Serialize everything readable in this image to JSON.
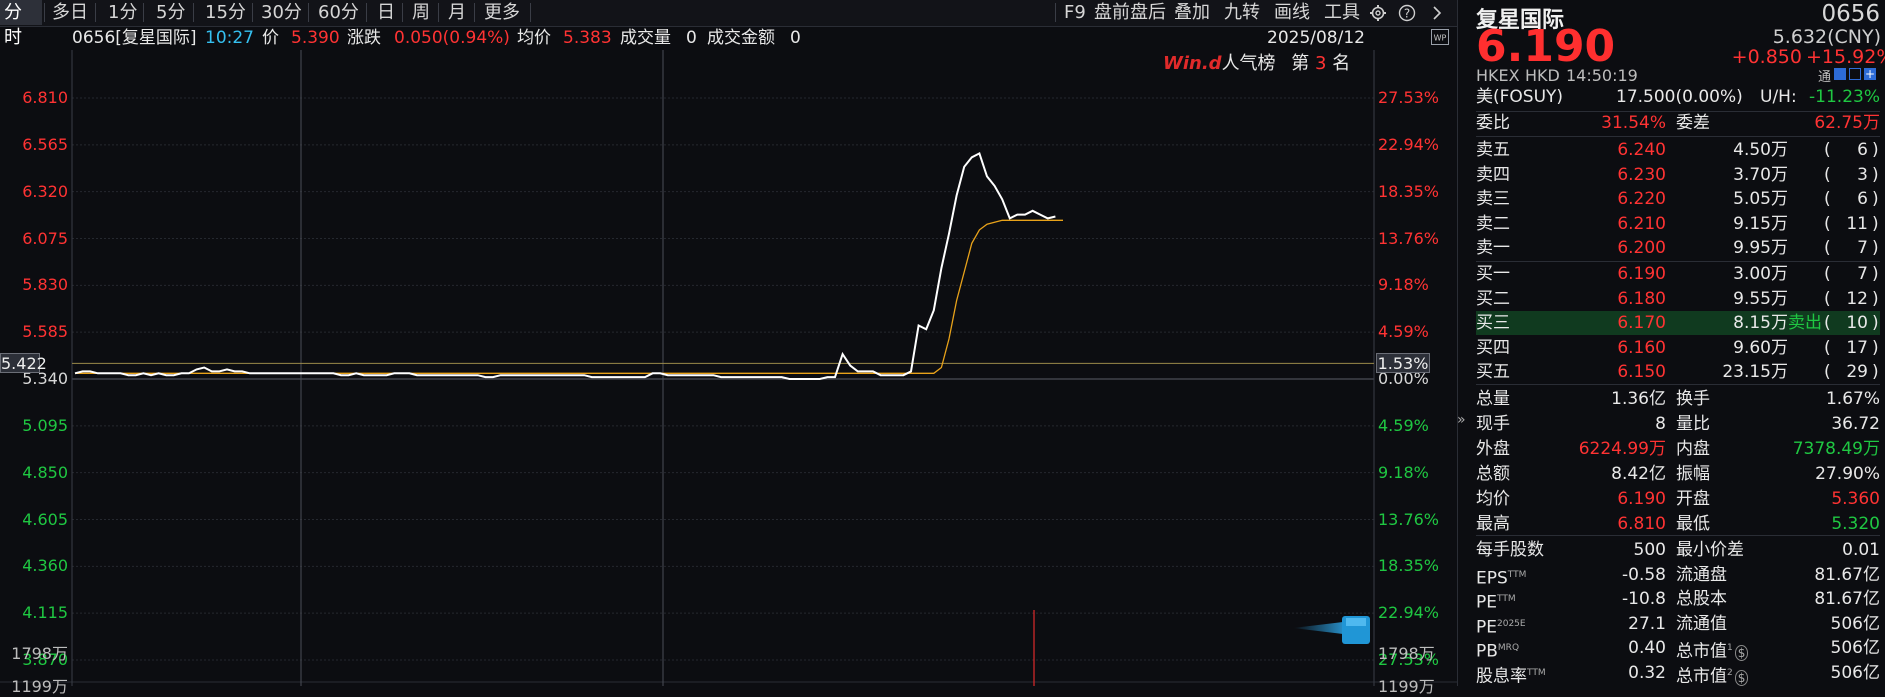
{
  "toolbar": {
    "tabs": [
      "分时",
      "多日",
      "1分",
      "5分",
      "15分",
      "30分",
      "60分",
      "日",
      "周",
      "月",
      "更多"
    ],
    "right_items": [
      "F9",
      "盘前盘后",
      "叠加",
      "九转",
      "画线",
      "工具"
    ],
    "gear_icon": "gear-icon",
    "help_icon": "help-icon",
    "next_icon": "chevron-right-icon"
  },
  "info": {
    "code_name": "0656[复星国际]",
    "time": "10:27",
    "price_label": "价",
    "price": "5.390",
    "change_label": "涨跌",
    "change": "0.050(0.94%)",
    "avg_label": "均价",
    "avg": "5.383",
    "volume_label": "成交量",
    "volume": "0",
    "amount_label": "成交金额",
    "amount": "0",
    "date": "2025/08/12"
  },
  "badge": {
    "brand": "Win.d",
    "rank_label": "人气榜",
    "rank_prefix": "第",
    "rank": "3",
    "rank_suffix": "名"
  },
  "chart_data": {
    "type": "line",
    "prev_close": 5.34,
    "current_line_value": 5.422,
    "current_line_label": "5.422",
    "current_line_pct": "1.53%",
    "ylim": [
      3.87,
      6.81
    ],
    "left_ticks": [
      "6.810",
      "6.565",
      "6.320",
      "6.075",
      "5.830",
      "5.585",
      "5.340",
      "5.095",
      "4.850",
      "4.605",
      "4.360",
      "4.115",
      "3.870"
    ],
    "right_ticks": [
      "27.53%",
      "22.94%",
      "18.35%",
      "13.76%",
      "9.18%",
      "4.59%",
      "0.00%",
      "4.59%",
      "9.18%",
      "13.76%",
      "18.35%",
      "22.94%",
      "27.53%"
    ],
    "volume_tick_left": "1798万",
    "volume_tick_right": "1798万",
    "volume_tick_next_left": "1199万",
    "volume_tick_next_right": "1199万",
    "series": [
      {
        "values": [
          5.37,
          5.38,
          5.38,
          5.37,
          5.37,
          5.37,
          5.37,
          5.36,
          5.36,
          5.37,
          5.36,
          5.37,
          5.36,
          5.36,
          5.37,
          5.37,
          5.39,
          5.4,
          5.38,
          5.38,
          5.39,
          5.38,
          5.38,
          5.37,
          5.37,
          5.37,
          5.37,
          5.37,
          5.37,
          5.37,
          5.37,
          5.37,
          5.37,
          5.37,
          5.37,
          5.36,
          5.36,
          5.37,
          5.36,
          5.36,
          5.36,
          5.36,
          5.37,
          5.37,
          5.37,
          5.36,
          5.36,
          5.36,
          5.36,
          5.36,
          5.36,
          5.36,
          5.36,
          5.36,
          5.35,
          5.35,
          5.36,
          5.36,
          5.36,
          5.36,
          5.36,
          5.36,
          5.36,
          5.36,
          5.36,
          5.36,
          5.36,
          5.36,
          5.35,
          5.35,
          5.35,
          5.35,
          5.35,
          5.35,
          5.35,
          5.35,
          5.37,
          5.37,
          5.36,
          5.36,
          5.36,
          5.36,
          5.36,
          5.36,
          5.36,
          5.35,
          5.35,
          5.35,
          5.35,
          5.35,
          5.35,
          5.35,
          5.35,
          5.35,
          5.34,
          5.34,
          5.34,
          5.34,
          5.34,
          5.35,
          5.35,
          5.47,
          5.41,
          5.38,
          5.38,
          5.38,
          5.36,
          5.36,
          5.36,
          5.36,
          5.38,
          5.62,
          5.6,
          5.7,
          5.92,
          6.1,
          6.3,
          6.45,
          6.5,
          6.52,
          6.4,
          6.35,
          6.28,
          6.18,
          6.2,
          6.2,
          6.22,
          6.2,
          6.18,
          6.19
        ]
      },
      {
        "values": [
          5.37,
          5.37,
          5.37,
          5.37,
          5.37,
          5.37,
          5.37,
          5.37,
          5.37,
          5.37,
          5.37,
          5.37,
          5.37,
          5.37,
          5.37,
          5.37,
          5.37,
          5.37,
          5.37,
          5.37,
          5.37,
          5.37,
          5.37,
          5.37,
          5.37,
          5.37,
          5.37,
          5.37,
          5.37,
          5.37,
          5.37,
          5.37,
          5.37,
          5.37,
          5.37,
          5.37,
          5.37,
          5.37,
          5.37,
          5.37,
          5.37,
          5.37,
          5.37,
          5.37,
          5.37,
          5.37,
          5.37,
          5.37,
          5.37,
          5.37,
          5.37,
          5.37,
          5.37,
          5.37,
          5.37,
          5.37,
          5.37,
          5.37,
          5.37,
          5.37,
          5.37,
          5.37,
          5.37,
          5.37,
          5.37,
          5.37,
          5.37,
          5.37,
          5.37,
          5.37,
          5.37,
          5.37,
          5.37,
          5.37,
          5.37,
          5.37,
          5.37,
          5.37,
          5.37,
          5.37,
          5.37,
          5.37,
          5.37,
          5.37,
          5.37,
          5.37,
          5.37,
          5.37,
          5.37,
          5.37,
          5.37,
          5.37,
          5.37,
          5.37,
          5.37,
          5.37,
          5.37,
          5.37,
          5.37,
          5.37,
          5.37,
          5.37,
          5.37,
          5.37,
          5.37,
          5.37,
          5.37,
          5.37,
          5.37,
          5.37,
          5.37,
          5.37,
          5.37,
          5.37,
          5.4,
          5.55,
          5.75,
          5.9,
          6.05,
          6.12,
          6.15,
          6.16,
          6.17,
          6.17,
          6.17,
          6.17,
          6.17,
          6.17,
          6.17,
          6.17,
          6.17
        ]
      }
    ]
  },
  "panel": {
    "name": "复星国际",
    "code": "0656",
    "price": "6.190",
    "cny_price": "5.632(CNY)",
    "change": "+0.850",
    "change_pct": "+15.92%",
    "exchange": "HKEX",
    "currency": "HKD",
    "time": "14:50:19",
    "tong": "通",
    "us_label": "美(FOSUY)",
    "us_value": "17.500(0.00%)",
    "uh_label": "U/H:",
    "uh_value": "-11.23%",
    "weibi_label": "委比",
    "weibi": "31.54%",
    "weicha_label": "委差",
    "weicha": "62.75万",
    "asks": [
      {
        "label": "卖五",
        "price": "6.240",
        "vol": "4.50万",
        "count": "6"
      },
      {
        "label": "卖四",
        "price": "6.230",
        "vol": "3.70万",
        "count": "3"
      },
      {
        "label": "卖三",
        "price": "6.220",
        "vol": "5.05万",
        "count": "6"
      },
      {
        "label": "卖二",
        "price": "6.210",
        "vol": "9.15万",
        "count": "11"
      },
      {
        "label": "卖一",
        "price": "6.200",
        "vol": "9.95万",
        "count": "7"
      }
    ],
    "bids": [
      {
        "label": "买一",
        "price": "6.190",
        "vol": "3.00万",
        "count": "7"
      },
      {
        "label": "买二",
        "price": "6.180",
        "vol": "9.55万",
        "count": "12"
      },
      {
        "label": "买三",
        "price": "6.170",
        "vol": "8.15万",
        "count": "10",
        "tag": "卖出"
      },
      {
        "label": "买四",
        "price": "6.160",
        "vol": "9.60万",
        "count": "17"
      },
      {
        "label": "买五",
        "price": "6.150",
        "vol": "23.15万",
        "count": "29"
      }
    ],
    "stats": [
      {
        "l1": "总量",
        "v1": "1.36亿",
        "c1": "white",
        "l2": "换手",
        "v2": "1.67%",
        "c2": "white"
      },
      {
        "l1": "现手",
        "v1": "8",
        "c1": "white",
        "l2": "量比",
        "v2": "36.72",
        "c2": "white"
      },
      {
        "l1": "外盘",
        "v1": "6224.99万",
        "c1": "red",
        "l2": "内盘",
        "v2": "7378.49万",
        "c2": "green"
      },
      {
        "l1": "总额",
        "v1": "8.42亿",
        "c1": "white",
        "l2": "振幅",
        "v2": "27.90%",
        "c2": "white"
      },
      {
        "l1": "均价",
        "v1": "6.190",
        "c1": "red",
        "l2": "开盘",
        "v2": "5.360",
        "c2": "red"
      },
      {
        "l1": "最高",
        "v1": "6.810",
        "c1": "red",
        "l2": "最低",
        "v2": "5.320",
        "c2": "green"
      }
    ],
    "stats2": [
      {
        "l1": "每手股数",
        "v1": "500",
        "l2": "最小价差",
        "v2": "0.01"
      },
      {
        "l1": "EPS",
        "s1": "TTM",
        "v1": "-0.58",
        "l2": "流通盘",
        "v2": "81.67亿"
      },
      {
        "l1": "PE",
        "s1": "TTM",
        "v1": "-10.8",
        "l2": "总股本",
        "v2": "81.67亿"
      },
      {
        "l1": "PE",
        "s1": "2025E",
        "v1": "27.1",
        "l2": "流通值",
        "v2": "506亿"
      },
      {
        "l1": "PB",
        "s1": "MRQ",
        "v1": "0.40",
        "l2": "总市值",
        "s2": "1",
        "v2": "506亿"
      },
      {
        "l1": "股息率",
        "s1": "TTM",
        "v1": "0.32",
        "l2": "总市值",
        "s2": "2",
        "v2": "506亿"
      }
    ]
  }
}
